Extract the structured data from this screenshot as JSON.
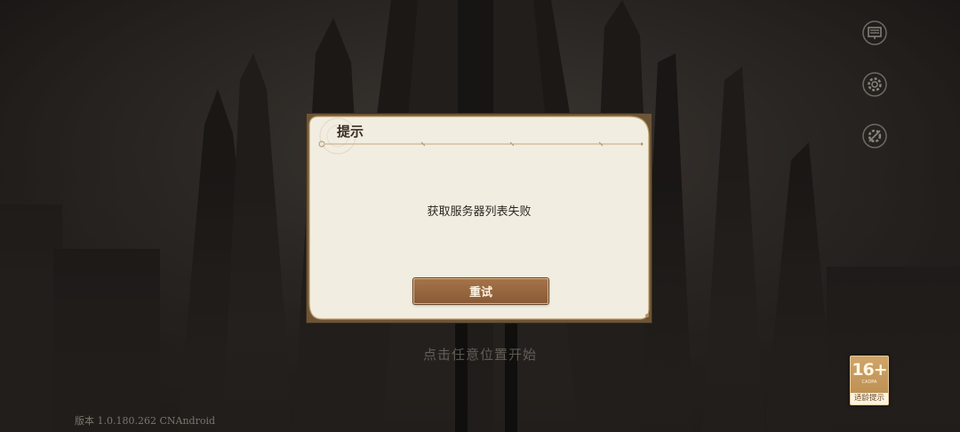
{
  "dialog": {
    "title": "提示",
    "message": "获取服务器列表失败",
    "retry_label": "重试"
  },
  "background": {
    "tap_hint": "点击任意位置开始",
    "version": "版本 1.0.180.262 CNAndroid"
  },
  "age_rating": {
    "age": "16+",
    "sub": "CADPA",
    "label": "适龄提示"
  },
  "side_buttons": [
    {
      "icon": "notice-board-icon"
    },
    {
      "icon": "settings-gear-icon"
    },
    {
      "icon": "repair-tools-icon"
    }
  ],
  "colors": {
    "dialog_bg": "#f2ede1",
    "dialog_border": "#b08a55",
    "button": "#986740"
  }
}
